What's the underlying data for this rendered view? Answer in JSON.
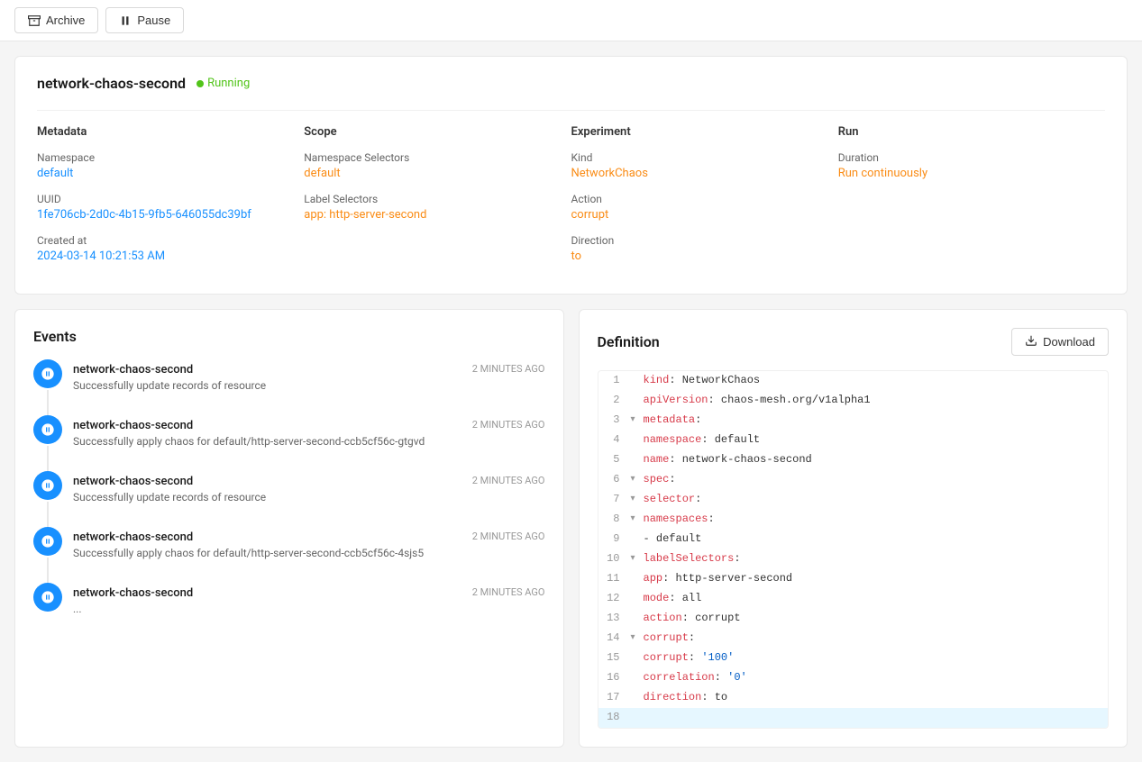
{
  "toolbar": {
    "archive_label": "Archive",
    "pause_label": "Pause"
  },
  "experiment": {
    "name": "network-chaos-second",
    "status": "Running",
    "metadata": {
      "title": "Metadata",
      "namespace_label": "Namespace",
      "namespace_value": "default",
      "uuid_label": "UUID",
      "uuid_value": "1fe706cb-2d0c-4b15-9fb5-646055dc39bf",
      "created_at_label": "Created at",
      "created_at_value": "2024-03-14 10:21:53 AM"
    },
    "scope": {
      "title": "Scope",
      "namespace_selectors_label": "Namespace Selectors",
      "namespace_selectors_value": "default",
      "label_selectors_label": "Label Selectors",
      "label_selectors_value": "app: http-server-second"
    },
    "experiment_info": {
      "title": "Experiment",
      "kind_label": "Kind",
      "kind_value": "NetworkChaos",
      "action_label": "Action",
      "action_value": "corrupt",
      "direction_label": "Direction",
      "direction_value": "to"
    },
    "run": {
      "title": "Run",
      "duration_label": "Duration",
      "duration_value": "Run continuously"
    }
  },
  "events": {
    "title": "Events",
    "items": [
      {
        "name": "network-chaos-second",
        "description": "Successfully update records of resource",
        "time": "2 MINUTES AGO"
      },
      {
        "name": "network-chaos-second",
        "description": "Successfully apply chaos for default/http-server-second-ccb5cf56c-gtgvd",
        "time": "2 MINUTES AGO"
      },
      {
        "name": "network-chaos-second",
        "description": "Successfully update records of resource",
        "time": "2 MINUTES AGO"
      },
      {
        "name": "network-chaos-second",
        "description": "Successfully apply chaos for default/http-server-second-ccb5cf56c-4sjs5",
        "time": "2 MINUTES AGO"
      },
      {
        "name": "network-chaos-second",
        "description": "...",
        "time": "2 MINUTES AGO"
      }
    ]
  },
  "definition": {
    "title": "Definition",
    "download_label": "Download",
    "code_lines": [
      {
        "num": 1,
        "arrow": "",
        "content": "kind: NetworkChaos",
        "highlighted": false
      },
      {
        "num": 2,
        "arrow": "",
        "content": "apiVersion: chaos-mesh.org/v1alpha1",
        "highlighted": false
      },
      {
        "num": 3,
        "arrow": "▾",
        "content": "metadata:",
        "highlighted": false
      },
      {
        "num": 4,
        "arrow": "",
        "content": "  namespace: default",
        "highlighted": false
      },
      {
        "num": 5,
        "arrow": "",
        "content": "  name: network-chaos-second",
        "highlighted": false
      },
      {
        "num": 6,
        "arrow": "▾",
        "content": "spec:",
        "highlighted": false
      },
      {
        "num": 7,
        "arrow": "▾",
        "content": "  selector:",
        "highlighted": false
      },
      {
        "num": 8,
        "arrow": "▾",
        "content": "    namespaces:",
        "highlighted": false
      },
      {
        "num": 9,
        "arrow": "",
        "content": "      - default",
        "highlighted": false
      },
      {
        "num": 10,
        "arrow": "▾",
        "content": "    labelSelectors:",
        "highlighted": false
      },
      {
        "num": 11,
        "arrow": "",
        "content": "      app: http-server-second",
        "highlighted": false
      },
      {
        "num": 12,
        "arrow": "",
        "content": "  mode: all",
        "highlighted": false
      },
      {
        "num": 13,
        "arrow": "",
        "content": "  action: corrupt",
        "highlighted": false
      },
      {
        "num": 14,
        "arrow": "▾",
        "content": "  corrupt:",
        "highlighted": false
      },
      {
        "num": 15,
        "arrow": "",
        "content": "    corrupt: '100'",
        "highlighted": false
      },
      {
        "num": 16,
        "arrow": "",
        "content": "    correlation: '0'",
        "highlighted": false
      },
      {
        "num": 17,
        "arrow": "",
        "content": "  direction: to",
        "highlighted": false
      },
      {
        "num": 18,
        "arrow": "",
        "content": "",
        "highlighted": true
      }
    ]
  }
}
